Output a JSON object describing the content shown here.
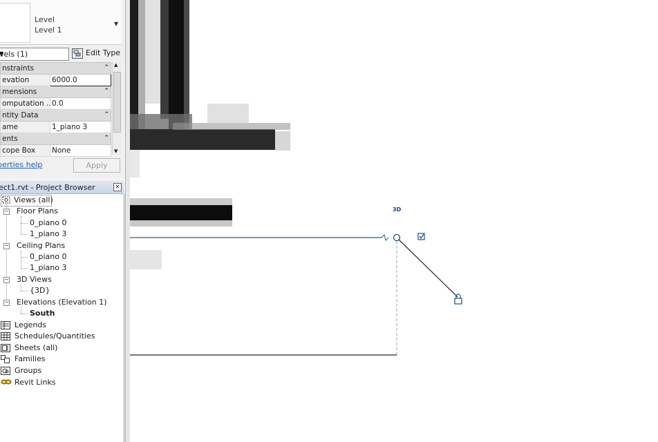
{
  "properties": {
    "type_name_line1": "Level",
    "type_name_line2": "Level 1",
    "type_dropdown_icon": "chevron-down-icon",
    "filter_value": "vels (1)",
    "edit_type_label": "Edit Type",
    "groups": [
      {
        "label": "nstraints",
        "rows": [
          {
            "name": "evation",
            "value": "6000.0"
          }
        ]
      },
      {
        "label": "mensions",
        "rows": [
          {
            "name": "omputation ...",
            "value": "0.0"
          }
        ]
      },
      {
        "label": "ntity Data",
        "rows": [
          {
            "name": "ame",
            "value": "1_piano 3"
          }
        ]
      },
      {
        "label": "ents",
        "rows": [
          {
            "name": "cope Box",
            "value": "None"
          }
        ]
      }
    ],
    "help_link": "perties help",
    "apply_label": "Apply"
  },
  "project_browser": {
    "title": "ect1.rvt - Project Browser",
    "close_icon": "close-icon",
    "root": "Views (all)",
    "floor_plans": {
      "label": "Floor Plans",
      "items": [
        "0_piano 0",
        "1_piano 3"
      ]
    },
    "ceiling_plans": {
      "label": "Ceiling Plans",
      "items": [
        "0_piano 0",
        "1_piano 3"
      ]
    },
    "views_3d": {
      "label": "3D Views",
      "items": [
        "{3D}"
      ]
    },
    "elevations": {
      "label": "Elevations (Elevation 1)",
      "items": [
        "South"
      ]
    },
    "legends": "Legends",
    "schedules": "Schedules/Quantities",
    "sheets": "Sheets (all)",
    "families": "Families",
    "groups": "Groups",
    "revit_links": "Revit Links"
  },
  "canvas": {
    "label_3d": "3D",
    "colors": {
      "level_line": "#2c5a7a",
      "handle": "#1f4f8a",
      "dash": "#8aa4bf",
      "dark": "#111111"
    }
  }
}
